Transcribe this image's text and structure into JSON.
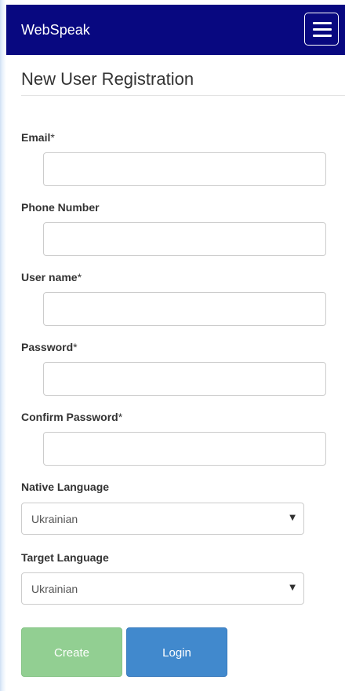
{
  "header": {
    "brand": "WebSpeak"
  },
  "page": {
    "title": "New User Registration"
  },
  "form": {
    "email": {
      "label": "Email",
      "required_mark": "*",
      "value": ""
    },
    "phone": {
      "label": "Phone Number",
      "value": ""
    },
    "username": {
      "label": "User name",
      "required_mark": "*",
      "value": ""
    },
    "password": {
      "label": "Password",
      "required_mark": "*",
      "value": ""
    },
    "confirm_password": {
      "label": "Confirm Password",
      "required_mark": "*",
      "value": ""
    },
    "native_language": {
      "label": "Native Language",
      "selected": "Ukrainian"
    },
    "target_language": {
      "label": "Target Language",
      "selected": "Ukrainian"
    }
  },
  "actions": {
    "create_label": "Create",
    "login_label": "Login"
  },
  "colors": {
    "navbar": "#080880",
    "create_button": "#92cf92",
    "login_button": "#4189cd"
  },
  "icons": {
    "menu": "hamburger-icon",
    "select_arrow": "caret-down-icon"
  }
}
